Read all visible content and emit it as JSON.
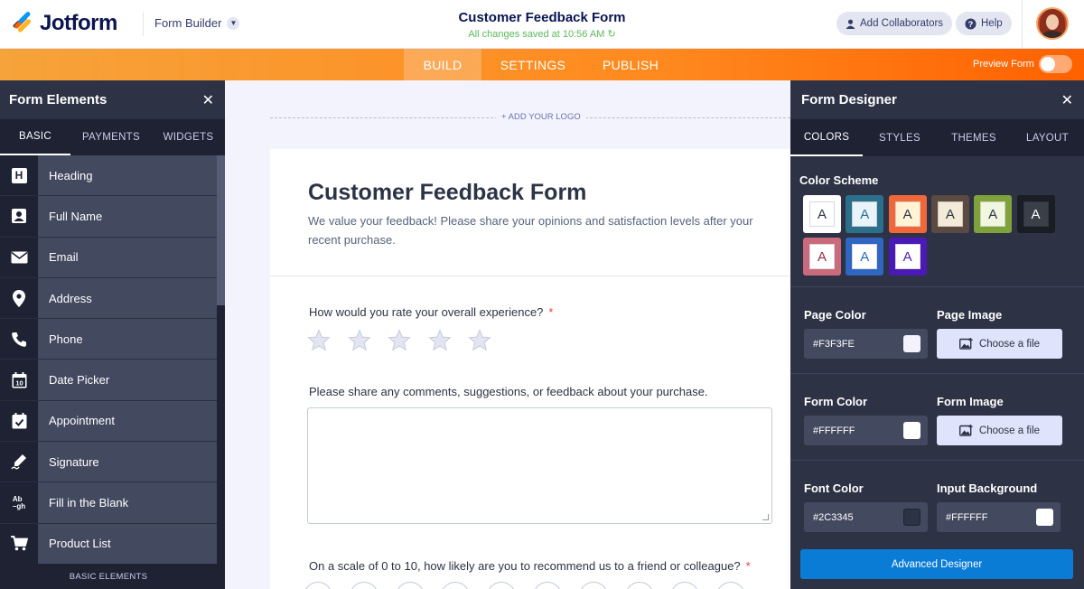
{
  "app": {
    "name": "Jotform",
    "builder_label": "Form Builder"
  },
  "header": {
    "form_title": "Customer Feedback Form",
    "save_status": "All changes saved at 10:56 AM",
    "add_collaborators": "Add Collaborators",
    "help": "Help"
  },
  "nav": {
    "tabs": [
      "BUILD",
      "SETTINGS",
      "PUBLISH"
    ],
    "active_tab": "BUILD",
    "preview_label": "Preview Form",
    "preview_on": false
  },
  "left_panel": {
    "title": "Form Elements",
    "tabs": [
      "BASIC",
      "PAYMENTS",
      "WIDGETS"
    ],
    "active_tab": "BASIC",
    "items": [
      {
        "icon": "heading-icon",
        "label": "Heading"
      },
      {
        "icon": "id-card-icon",
        "label": "Full Name"
      },
      {
        "icon": "envelope-icon",
        "label": "Email"
      },
      {
        "icon": "map-pin-icon",
        "label": "Address"
      },
      {
        "icon": "phone-icon",
        "label": "Phone"
      },
      {
        "icon": "calendar-icon",
        "label": "Date Picker"
      },
      {
        "icon": "calendar-check-icon",
        "label": "Appointment"
      },
      {
        "icon": "pen-icon",
        "label": "Signature"
      },
      {
        "icon": "fill-blank-icon",
        "label": "Fill in the Blank"
      },
      {
        "icon": "cart-icon",
        "label": "Product List"
      }
    ],
    "footer": "BASIC ELEMENTS"
  },
  "canvas": {
    "add_logo": "+ ADD YOUR LOGO",
    "form": {
      "heading": "Customer Feedback Form",
      "description": "We value your feedback! Please share your opinions and satisfaction levels after your recent purchase.",
      "q1": {
        "label": "How would you rate your overall experience?",
        "required": "*",
        "stars": 5
      },
      "q2": {
        "label": "Please share any comments, suggestions, or feedback about your purchase."
      },
      "q3": {
        "label": "On a scale of 0 to 10, how likely are you to recommend us to a friend or colleague?",
        "required": "*"
      }
    }
  },
  "right_panel": {
    "title": "Form Designer",
    "tabs": [
      "COLORS",
      "STYLES",
      "THEMES",
      "LAYOUT"
    ],
    "active_tab": "COLORS",
    "color_scheme_label": "Color Scheme",
    "schemes": [
      {
        "letter": "A",
        "bg": "#ffffff",
        "inner": "#ffffff",
        "fg": "#2c3345"
      },
      {
        "letter": "A",
        "bg": "#2b6f8b",
        "inner": "#e8f4fa",
        "fg": "#2b6f8b"
      },
      {
        "letter": "A",
        "bg": "#f2673a",
        "inner": "#fff3d6",
        "fg": "#2c3345"
      },
      {
        "letter": "A",
        "bg": "#5a4a42",
        "inner": "#f3ead8",
        "fg": "#2c3345"
      },
      {
        "letter": "A",
        "bg": "#7fa23a",
        "inner": "#f0f6df",
        "fg": "#2c3345"
      },
      {
        "letter": "A",
        "bg": "#1b1d24",
        "inner": "#3b3f4a",
        "fg": "#ffffff"
      },
      {
        "letter": "A",
        "bg": "#c96b7d",
        "inner": "#ffffff",
        "fg": "#9b2c3e"
      },
      {
        "letter": "A",
        "bg": "#2f66c2",
        "inner": "#ffffff",
        "fg": "#2f66c2"
      },
      {
        "letter": "A",
        "bg": "#4b19b5",
        "inner": "#ffffff",
        "fg": "#4b19b5"
      }
    ],
    "page_color": {
      "label": "Page Color",
      "value": "#F3F3FE",
      "swatch": "#f3f3fe"
    },
    "page_image": {
      "label": "Page Image",
      "button": "Choose a file"
    },
    "form_color": {
      "label": "Form Color",
      "value": "#FFFFFF",
      "swatch": "#ffffff"
    },
    "form_image": {
      "label": "Form Image",
      "button": "Choose a file"
    },
    "font_color": {
      "label": "Font Color",
      "value": "#2C3345",
      "swatch": "#2c3345"
    },
    "input_background": {
      "label": "Input Background",
      "value": "#FFFFFF",
      "swatch": "#ffffff"
    },
    "advanced_button": "Advanced Designer"
  }
}
